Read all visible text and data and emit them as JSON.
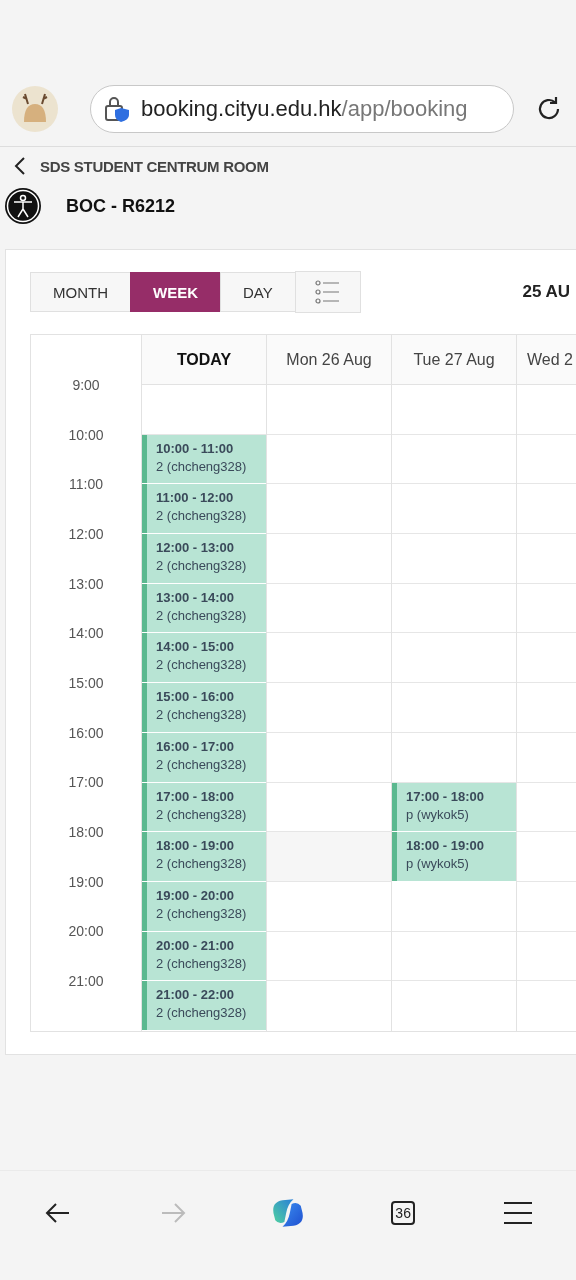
{
  "browser": {
    "url_host": "booking.cityu.edu.hk",
    "url_path": "/app/booking"
  },
  "breadcrumb": {
    "label": "SDS STUDENT CENTRUM ROOM"
  },
  "room": {
    "title": "BOC - R6212"
  },
  "views": [
    {
      "label": "MONTH",
      "selected": false
    },
    {
      "label": "WEEK",
      "selected": true
    },
    {
      "label": "DAY",
      "selected": false
    }
  ],
  "date_range": "25 AU",
  "days": [
    {
      "label": "TODAY",
      "today": true
    },
    {
      "label": "Mon 26 Aug",
      "today": false
    },
    {
      "label": "Tue 27 Aug",
      "today": false
    },
    {
      "label": "Wed 2",
      "today": false
    }
  ],
  "rows": [
    {
      "time": "9:00",
      "cells": [
        {
          "kind": "empty"
        },
        {
          "kind": "empty"
        },
        {
          "kind": "empty"
        },
        {
          "kind": "empty"
        }
      ]
    },
    {
      "time": "10:00",
      "cells": [
        {
          "kind": "booking",
          "time": "10:00 - 11:00",
          "who": "2 (chcheng328)"
        },
        {
          "kind": "empty"
        },
        {
          "kind": "empty"
        },
        {
          "kind": "empty"
        }
      ]
    },
    {
      "time": "11:00",
      "cells": [
        {
          "kind": "booking",
          "time": "11:00 - 12:00",
          "who": "2 (chcheng328)"
        },
        {
          "kind": "empty"
        },
        {
          "kind": "empty"
        },
        {
          "kind": "empty"
        }
      ]
    },
    {
      "time": "12:00",
      "cells": [
        {
          "kind": "booking",
          "time": "12:00 - 13:00",
          "who": "2 (chcheng328)"
        },
        {
          "kind": "empty"
        },
        {
          "kind": "empty"
        },
        {
          "kind": "empty"
        }
      ]
    },
    {
      "time": "13:00",
      "cells": [
        {
          "kind": "booking",
          "time": "13:00 - 14:00",
          "who": "2 (chcheng328)"
        },
        {
          "kind": "empty"
        },
        {
          "kind": "empty"
        },
        {
          "kind": "empty"
        }
      ]
    },
    {
      "time": "14:00",
      "cells": [
        {
          "kind": "booking",
          "time": "14:00 - 15:00",
          "who": "2 (chcheng328)"
        },
        {
          "kind": "empty"
        },
        {
          "kind": "empty"
        },
        {
          "kind": "empty"
        }
      ]
    },
    {
      "time": "15:00",
      "cells": [
        {
          "kind": "booking",
          "time": "15:00 - 16:00",
          "who": "2 (chcheng328)"
        },
        {
          "kind": "empty"
        },
        {
          "kind": "empty"
        },
        {
          "kind": "empty"
        }
      ]
    },
    {
      "time": "16:00",
      "cells": [
        {
          "kind": "booking",
          "time": "16:00 - 17:00",
          "who": "2 (chcheng328)"
        },
        {
          "kind": "empty"
        },
        {
          "kind": "empty"
        },
        {
          "kind": "empty"
        }
      ]
    },
    {
      "time": "17:00",
      "cells": [
        {
          "kind": "booking",
          "time": "17:00 - 18:00",
          "who": "2 (chcheng328)"
        },
        {
          "kind": "empty"
        },
        {
          "kind": "booking",
          "time": "17:00 - 18:00",
          "who": "p (wykok5)"
        },
        {
          "kind": "empty"
        }
      ]
    },
    {
      "time": "18:00",
      "cells": [
        {
          "kind": "booking",
          "time": "18:00 - 19:00",
          "who": "2 (chcheng328)"
        },
        {
          "kind": "shaded"
        },
        {
          "kind": "booking",
          "time": "18:00 - 19:00",
          "who": "p (wykok5)"
        },
        {
          "kind": "empty"
        }
      ]
    },
    {
      "time": "19:00",
      "cells": [
        {
          "kind": "booking",
          "time": "19:00 - 20:00",
          "who": "2 (chcheng328)"
        },
        {
          "kind": "empty"
        },
        {
          "kind": "empty"
        },
        {
          "kind": "empty"
        }
      ]
    },
    {
      "time": "20:00",
      "cells": [
        {
          "kind": "booking",
          "time": "20:00 - 21:00",
          "who": "2 (chcheng328)"
        },
        {
          "kind": "empty"
        },
        {
          "kind": "empty"
        },
        {
          "kind": "empty"
        }
      ]
    },
    {
      "time": "21:00",
      "cells": [
        {
          "kind": "booking",
          "time": "21:00 - 22:00",
          "who": "2 (chcheng328)"
        },
        {
          "kind": "empty"
        },
        {
          "kind": "empty"
        },
        {
          "kind": "empty"
        }
      ]
    }
  ],
  "bottom_bar": {
    "forward_disabled": true,
    "tab_count": "36"
  }
}
